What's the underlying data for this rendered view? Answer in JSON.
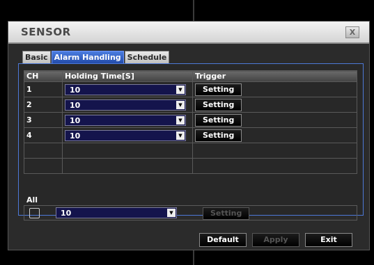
{
  "dialog": {
    "title": "SENSOR",
    "close_label": "X"
  },
  "tabs": [
    {
      "label": "Basic"
    },
    {
      "label": "Alarm Handling"
    },
    {
      "label": "Schedule"
    }
  ],
  "table": {
    "headers": {
      "ch": "CH",
      "holding": "Holding Time[S]",
      "trigger": "Trigger"
    },
    "rows": [
      {
        "ch": "1",
        "holding": "10",
        "trigger": "Setting"
      },
      {
        "ch": "2",
        "holding": "10",
        "trigger": "Setting"
      },
      {
        "ch": "3",
        "holding": "10",
        "trigger": "Setting"
      },
      {
        "ch": "4",
        "holding": "10",
        "trigger": "Setting"
      }
    ]
  },
  "all": {
    "label": "All",
    "holding": "10",
    "trigger": "Setting"
  },
  "footer": {
    "default": "Default",
    "apply": "Apply",
    "exit": "Exit"
  },
  "colors": {
    "active_tab": "#2f5fcf",
    "panel_border": "#4d79d8",
    "combo_bg": "#14144c"
  },
  "icons": {
    "close": "close-icon",
    "dropdown": "chevron-down-icon"
  }
}
